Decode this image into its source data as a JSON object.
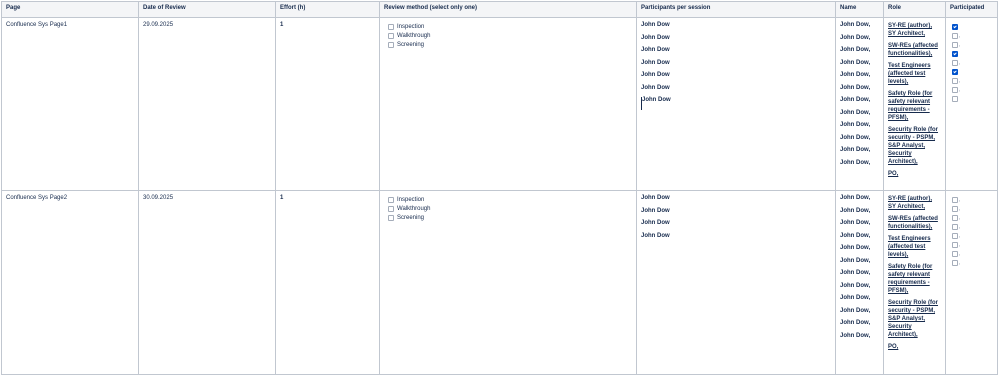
{
  "headers": {
    "page": "Page",
    "date": "Date of Review",
    "effort": "Effort (h)",
    "method": "Review method (select only one)",
    "participants": "Participants per session",
    "name": "Name",
    "role": "Role",
    "participated": "Participated"
  },
  "rows": [
    {
      "page": "Confluence Sys Page1",
      "date": "29.09.2025",
      "effort": "1",
      "methods": [
        "Inspection",
        "Walkthrough",
        "Screening"
      ],
      "participants": [
        "John Dow",
        "John Dow",
        "John Dow",
        "John Dow",
        "John Dow",
        "John Dow",
        "John Dow"
      ],
      "names": [
        "John Dow,",
        "John Dow,",
        "John Dow,",
        "John Dow,",
        "John Dow,",
        "John Dow,",
        "John Dow,",
        "John Dow,",
        "John Dow,",
        "John Dow,",
        "John Dow,",
        "John Dow,"
      ],
      "roles": [
        "SY-RE (author), SY Architect,",
        "SW-REs (affected functionalities),",
        "Test Engineers (affected test levels),",
        "Safety Role (for safety relevant requirements - PFSM),",
        "Security Role (for security - PSPM, S&P Analyst, Security Architect),",
        "PO,"
      ],
      "participated": [
        true,
        false,
        false,
        true,
        false,
        true,
        false,
        false,
        false
      ],
      "participated_suffix": [
        "",
        ",",
        ",",
        "",
        ",",
        "",
        ",",
        ",",
        ""
      ]
    },
    {
      "page": "Confluence Sys Page2",
      "date": "30.09.2025",
      "effort": "1",
      "methods": [
        "Inspection",
        "Walkthrough",
        "Screening"
      ],
      "participants": [
        "John Dow",
        "John Dow",
        "John Dow",
        "John Dow"
      ],
      "names": [
        "John Dow,",
        "John Dow,",
        "John Dow,",
        "John Dow,",
        "John Dow,",
        "John Dow,",
        "John Dow,",
        "John Dow,",
        "John Dow,",
        "John Dow,",
        "John Dow,",
        "John Dow,"
      ],
      "roles": [
        "SY-RE (author), SY Architect,",
        "SW-REs (affected functionalities),",
        "Test Engineers (affected test levels),",
        "Safety Role (for safety relevant requirements - PFSM),",
        "Security Role (for security - PSPM, S&P Analyst, Security Architect),",
        "PO,"
      ],
      "participated": [
        false,
        false,
        false,
        false,
        false,
        false,
        false,
        false
      ],
      "participated_suffix": [
        ",",
        ",",
        ",",
        ",",
        ",",
        ",",
        ",",
        ","
      ]
    }
  ]
}
